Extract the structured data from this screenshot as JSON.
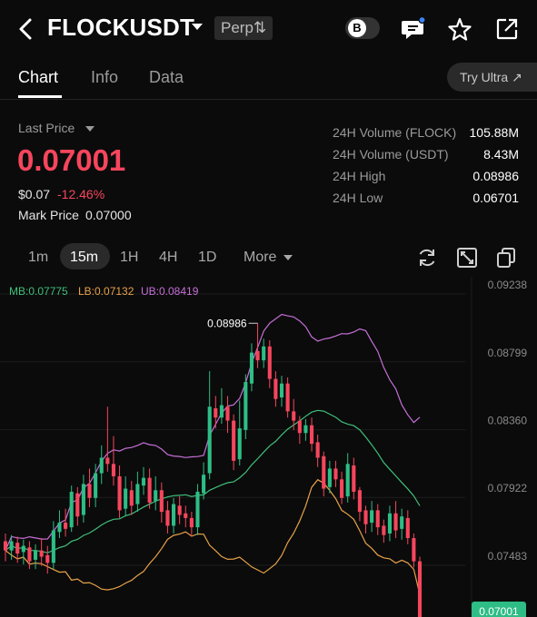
{
  "header": {
    "symbol": "FLOCKUSDT",
    "badge": "Perp",
    "badge_suffix": "⇅",
    "toggle_letter": "B",
    "icons": [
      "back-arrow-icon",
      "dropdown-caret-icon",
      "b-toggle-icon",
      "chat-icon",
      "star-icon",
      "share-icon"
    ],
    "notification_color": "#3b82f6"
  },
  "tabs": [
    {
      "label": "Chart",
      "active": true
    },
    {
      "label": "Info",
      "active": false
    },
    {
      "label": "Data",
      "active": false
    }
  ],
  "try_ultra": "Try Ultra ↗",
  "price": {
    "last_label": "Last Price",
    "last_price": "0.07001",
    "usd": "$0.07",
    "change": "-12.46%",
    "mark_label": "Mark Price",
    "mark_value": "0.07000",
    "down_color": "#f6465d",
    "up_color": "#2ebd85"
  },
  "stats": [
    {
      "label": "24H Volume (FLOCK)",
      "value": "105.88M"
    },
    {
      "label": "24H Volume (USDT)",
      "value": "8.43M"
    },
    {
      "label": "24H High",
      "value": "0.08986"
    },
    {
      "label": "24H Low",
      "value": "0.06701"
    }
  ],
  "intervals": [
    "1m",
    "15m",
    "1H",
    "4H",
    "1D",
    "More"
  ],
  "active_interval": "15m",
  "toolbar_icons": [
    "refresh-icon",
    "expand-icon",
    "copy-icon"
  ],
  "chart_data": {
    "type": "candlestick",
    "legend": [
      {
        "label": "MB:0.07775",
        "color": "#3fbf7a"
      },
      {
        "label": "LB:0.07132",
        "color": "#e8a24a"
      },
      {
        "label": "UB:0.08419",
        "color": "#c66fd8"
      }
    ],
    "y_ticks": [
      "0.09238",
      "0.08799",
      "0.08360",
      "0.07922",
      "0.07483"
    ],
    "ylim": [
      0.0695,
      0.0927
    ],
    "high_label": "0.08986",
    "current_price_tag": "0.07001",
    "candles": [
      [
        0.0758,
        0.0752,
        0.0763,
        0.0745
      ],
      [
        0.0752,
        0.0758,
        0.0762,
        0.0746
      ],
      [
        0.0757,
        0.075,
        0.0761,
        0.0744
      ],
      [
        0.0751,
        0.0755,
        0.0759,
        0.0743
      ],
      [
        0.0754,
        0.0745,
        0.0758,
        0.074
      ],
      [
        0.0746,
        0.0752,
        0.0756,
        0.074
      ],
      [
        0.0752,
        0.0748,
        0.076,
        0.0742
      ],
      [
        0.0749,
        0.0744,
        0.0755,
        0.0737
      ],
      [
        0.0744,
        0.0765,
        0.0771,
        0.074
      ],
      [
        0.0764,
        0.077,
        0.0778,
        0.076
      ],
      [
        0.077,
        0.0766,
        0.0779,
        0.0761
      ],
      [
        0.0767,
        0.079,
        0.0794,
        0.0764
      ],
      [
        0.0789,
        0.0774,
        0.0793,
        0.0768
      ],
      [
        0.0775,
        0.0795,
        0.0801,
        0.077
      ],
      [
        0.0795,
        0.0786,
        0.0805,
        0.078
      ],
      [
        0.0786,
        0.0802,
        0.0808,
        0.078
      ],
      [
        0.0802,
        0.0812,
        0.082,
        0.0795
      ],
      [
        0.0812,
        0.0808,
        0.0845,
        0.0803
      ],
      [
        0.0808,
        0.08,
        0.0826,
        0.0794
      ],
      [
        0.08,
        0.0778,
        0.0807,
        0.0773
      ],
      [
        0.0779,
        0.0792,
        0.08,
        0.0774
      ],
      [
        0.0791,
        0.0781,
        0.0797,
        0.0775
      ],
      [
        0.0782,
        0.0795,
        0.0803,
        0.0777
      ],
      [
        0.0794,
        0.0799,
        0.0806,
        0.0788
      ],
      [
        0.0799,
        0.0783,
        0.0805,
        0.0779
      ],
      [
        0.0784,
        0.0791,
        0.08,
        0.0778
      ],
      [
        0.0791,
        0.0777,
        0.0796,
        0.077
      ],
      [
        0.0778,
        0.0768,
        0.0784,
        0.0763
      ],
      [
        0.0768,
        0.0782,
        0.0786,
        0.0763
      ],
      [
        0.0781,
        0.0775,
        0.0787,
        0.0769
      ],
      [
        0.0776,
        0.0773,
        0.0781,
        0.0767
      ],
      [
        0.0773,
        0.0767,
        0.0777,
        0.0761
      ],
      [
        0.0767,
        0.079,
        0.0795,
        0.0762
      ],
      [
        0.0789,
        0.0801,
        0.0809,
        0.0785
      ],
      [
        0.0802,
        0.0845,
        0.0868,
        0.0798
      ],
      [
        0.0844,
        0.0838,
        0.0852,
        0.0831
      ],
      [
        0.0838,
        0.0846,
        0.0857,
        0.0834
      ],
      [
        0.0845,
        0.0836,
        0.0852,
        0.0828
      ],
      [
        0.0836,
        0.081,
        0.084,
        0.0804
      ],
      [
        0.0811,
        0.0831,
        0.0849,
        0.0807
      ],
      [
        0.083,
        0.0861,
        0.0866,
        0.0824
      ],
      [
        0.086,
        0.088,
        0.0886,
        0.0855
      ],
      [
        0.0881,
        0.0875,
        0.0899,
        0.087
      ],
      [
        0.0875,
        0.0884,
        0.0889,
        0.087
      ],
      [
        0.0884,
        0.0863,
        0.0888,
        0.0857
      ],
      [
        0.0863,
        0.085,
        0.0868,
        0.0845
      ],
      [
        0.0851,
        0.086,
        0.0865,
        0.0845
      ],
      [
        0.086,
        0.0842,
        0.0864,
        0.0838
      ],
      [
        0.0842,
        0.0836,
        0.085,
        0.083
      ],
      [
        0.0836,
        0.0828,
        0.0839,
        0.0821
      ],
      [
        0.0828,
        0.0833,
        0.0837,
        0.0823
      ],
      [
        0.0833,
        0.0821,
        0.0838,
        0.0816
      ],
      [
        0.0822,
        0.0812,
        0.0827,
        0.0806
      ],
      [
        0.0813,
        0.0792,
        0.0816,
        0.0787
      ],
      [
        0.0793,
        0.0805,
        0.081,
        0.0789
      ],
      [
        0.0805,
        0.0798,
        0.081,
        0.0793
      ],
      [
        0.0798,
        0.0786,
        0.0803,
        0.0782
      ],
      [
        0.0787,
        0.0808,
        0.0815,
        0.0783
      ],
      [
        0.0807,
        0.079,
        0.0812,
        0.0785
      ],
      [
        0.0791,
        0.0777,
        0.0793,
        0.0771
      ],
      [
        0.0778,
        0.0769,
        0.0781,
        0.0763
      ],
      [
        0.077,
        0.0778,
        0.0784,
        0.0764
      ],
      [
        0.0778,
        0.0767,
        0.0782,
        0.0762
      ],
      [
        0.0768,
        0.0762,
        0.0772,
        0.0757
      ],
      [
        0.0763,
        0.0776,
        0.0781,
        0.0758
      ],
      [
        0.0776,
        0.0765,
        0.0784,
        0.076
      ],
      [
        0.0766,
        0.0774,
        0.0779,
        0.0759
      ],
      [
        0.0773,
        0.076,
        0.0778,
        0.0756
      ],
      [
        0.076,
        0.0745,
        0.0763,
        0.0741
      ],
      [
        0.0745,
        0.07,
        0.0748,
        0.069
      ]
    ]
  }
}
